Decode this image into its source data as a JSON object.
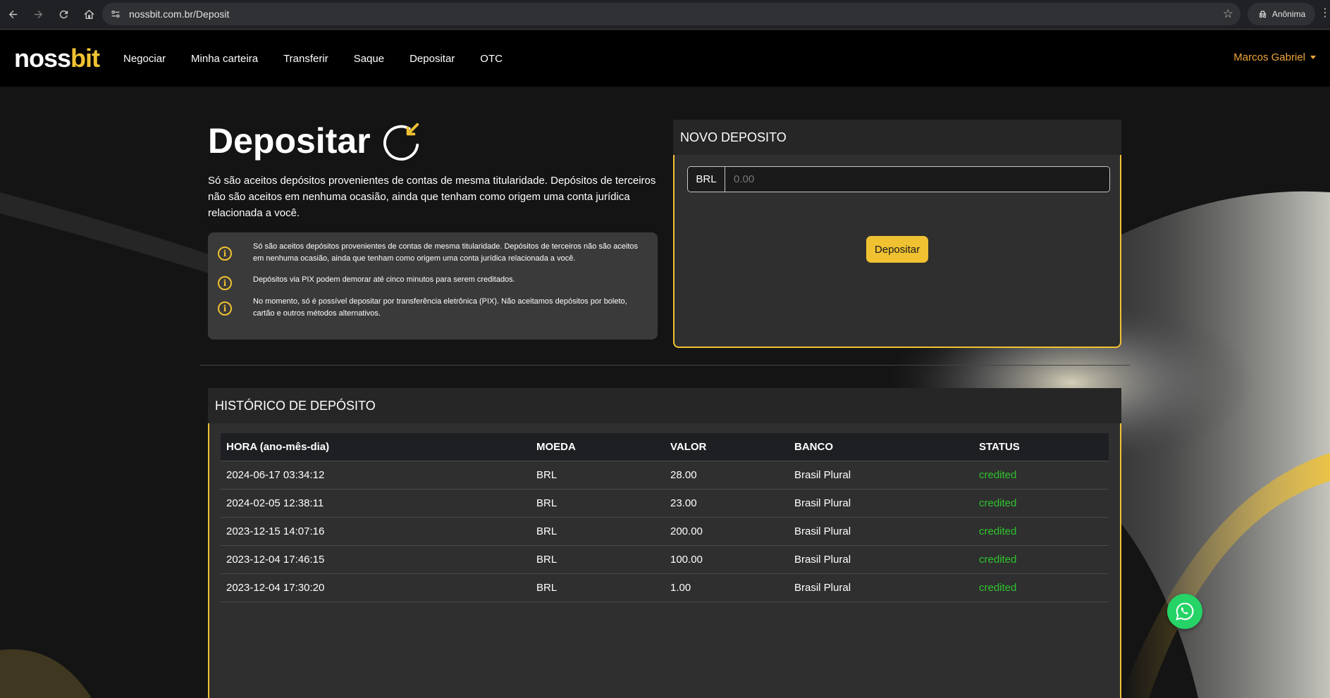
{
  "browser": {
    "url": "nossbit.com.br/Deposit",
    "profile_label": "Anônima"
  },
  "nav": {
    "logo_part1": "noss",
    "logo_part2": "bit",
    "items": [
      "Negociar",
      "Minha carteira",
      "Transferir",
      "Saque",
      "Depositar",
      "OTC"
    ],
    "user": "Marcos Gabriel"
  },
  "page": {
    "title": "Depositar",
    "intro": "Só são aceitos depósitos provenientes de contas de mesma titularidade. Depósitos de terceiros não são aceitos em nenhuma ocasião, ainda que tenham como origem uma conta jurídica relacionada a você.",
    "notices": [
      "Só são aceitos depósitos provenientes de contas de mesma titularidade. Depósitos de terceiros não são aceitos em nenhuma ocasião, ainda que tenham como origem uma conta jurídica relacionada a você.",
      "Depósitos via PIX podem demorar até cinco minutos para serem creditados.",
      "No momento, só é possível depositar por transferência eletrônica (PIX). Não aceitamos depósitos por boleto, cartão e outros métodos alternativos."
    ]
  },
  "new_deposit": {
    "heading": "NOVO DEPOSITO",
    "currency": "BRL",
    "amount_placeholder": "0.00",
    "button_label": "Depositar"
  },
  "history": {
    "heading": "HISTÓRICO DE DEPÓSITO",
    "columns": [
      "HORA (ano-mês-dia)",
      "MOEDA",
      "VALOR",
      "BANCO",
      "STATUS"
    ],
    "rows": [
      [
        "2024-06-17 03:34:12",
        "BRL",
        "28.00",
        "Brasil Plural",
        "credited"
      ],
      [
        "2024-02-05 12:38:11",
        "BRL",
        "23.00",
        "Brasil Plural",
        "credited"
      ],
      [
        "2023-12-15 14:07:16",
        "BRL",
        "200.00",
        "Brasil Plural",
        "credited"
      ],
      [
        "2023-12-04 17:46:15",
        "BRL",
        "100.00",
        "Brasil Plural",
        "credited"
      ],
      [
        "2023-12-04 17:30:20",
        "BRL",
        "1.00",
        "Brasil Plural",
        "credited"
      ]
    ]
  },
  "colors": {
    "accent": "#f0c232",
    "status_credited": "#2ec42e",
    "user_name": "#f0a53a"
  }
}
